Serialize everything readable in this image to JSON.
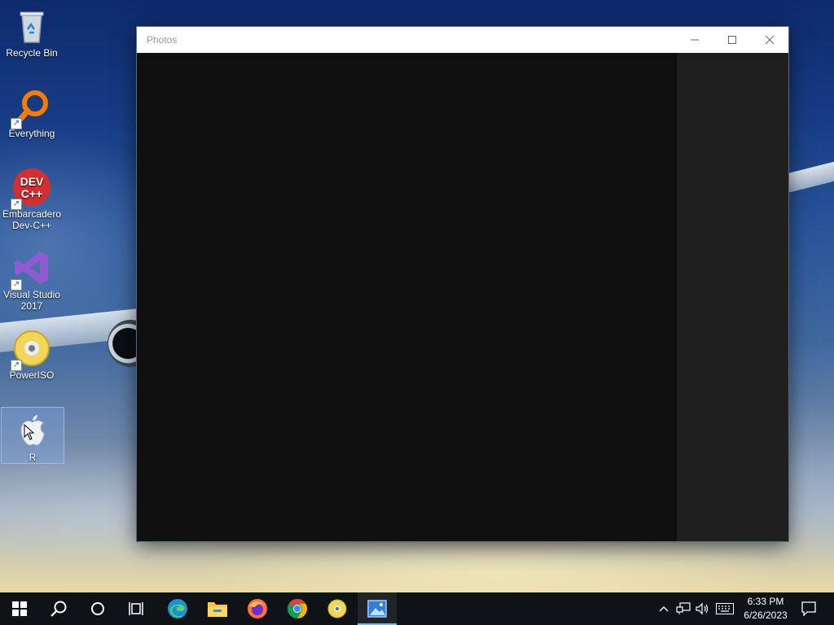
{
  "desktop": {
    "icons": [
      {
        "label": "Recycle Bin",
        "icon": "recycle-bin-icon"
      },
      {
        "label": "Everything",
        "icon": "everything-search-icon"
      },
      {
        "label": "Embarcadero Dev-C++",
        "icon": "devcpp-icon",
        "badge_text": "DEV C++"
      },
      {
        "label": "Visual Studio 2017",
        "icon": "visual-studio-icon"
      },
      {
        "label": "PowerISO",
        "icon": "poweriso-icon"
      },
      {
        "label": "R",
        "icon": "apple-icon",
        "selected": true
      }
    ]
  },
  "window": {
    "title": "Photos",
    "controls": {
      "minimize": "─",
      "maximize": "☐",
      "close": "✕"
    }
  },
  "taskbar": {
    "items": [
      {
        "name": "start",
        "icon": "windows-start-icon"
      },
      {
        "name": "search",
        "icon": "search-icon"
      },
      {
        "name": "cortana",
        "icon": "cortana-icon"
      },
      {
        "name": "task-view",
        "icon": "task-view-icon"
      },
      {
        "name": "edge",
        "icon": "edge-icon"
      },
      {
        "name": "file-explorer",
        "icon": "folder-icon"
      },
      {
        "name": "firefox",
        "icon": "firefox-icon"
      },
      {
        "name": "chrome",
        "icon": "chrome-icon"
      },
      {
        "name": "poweriso",
        "icon": "poweriso-icon"
      },
      {
        "name": "photos",
        "icon": "photos-icon",
        "active": true
      }
    ],
    "tray": {
      "chevron": "^",
      "network_icon": "network-icon",
      "volume_icon": "volume-icon",
      "keyboard_icon": "keyboard-icon",
      "notification_icon": "notification-icon"
    },
    "clock": {
      "time": "6:33 PM",
      "date": "6/26/2023"
    }
  },
  "colors": {
    "taskbar": "#101315",
    "active_indicator": "#76b9ed",
    "window_bg": "#0f0f0f",
    "side_panel": "#1f1f1f"
  }
}
